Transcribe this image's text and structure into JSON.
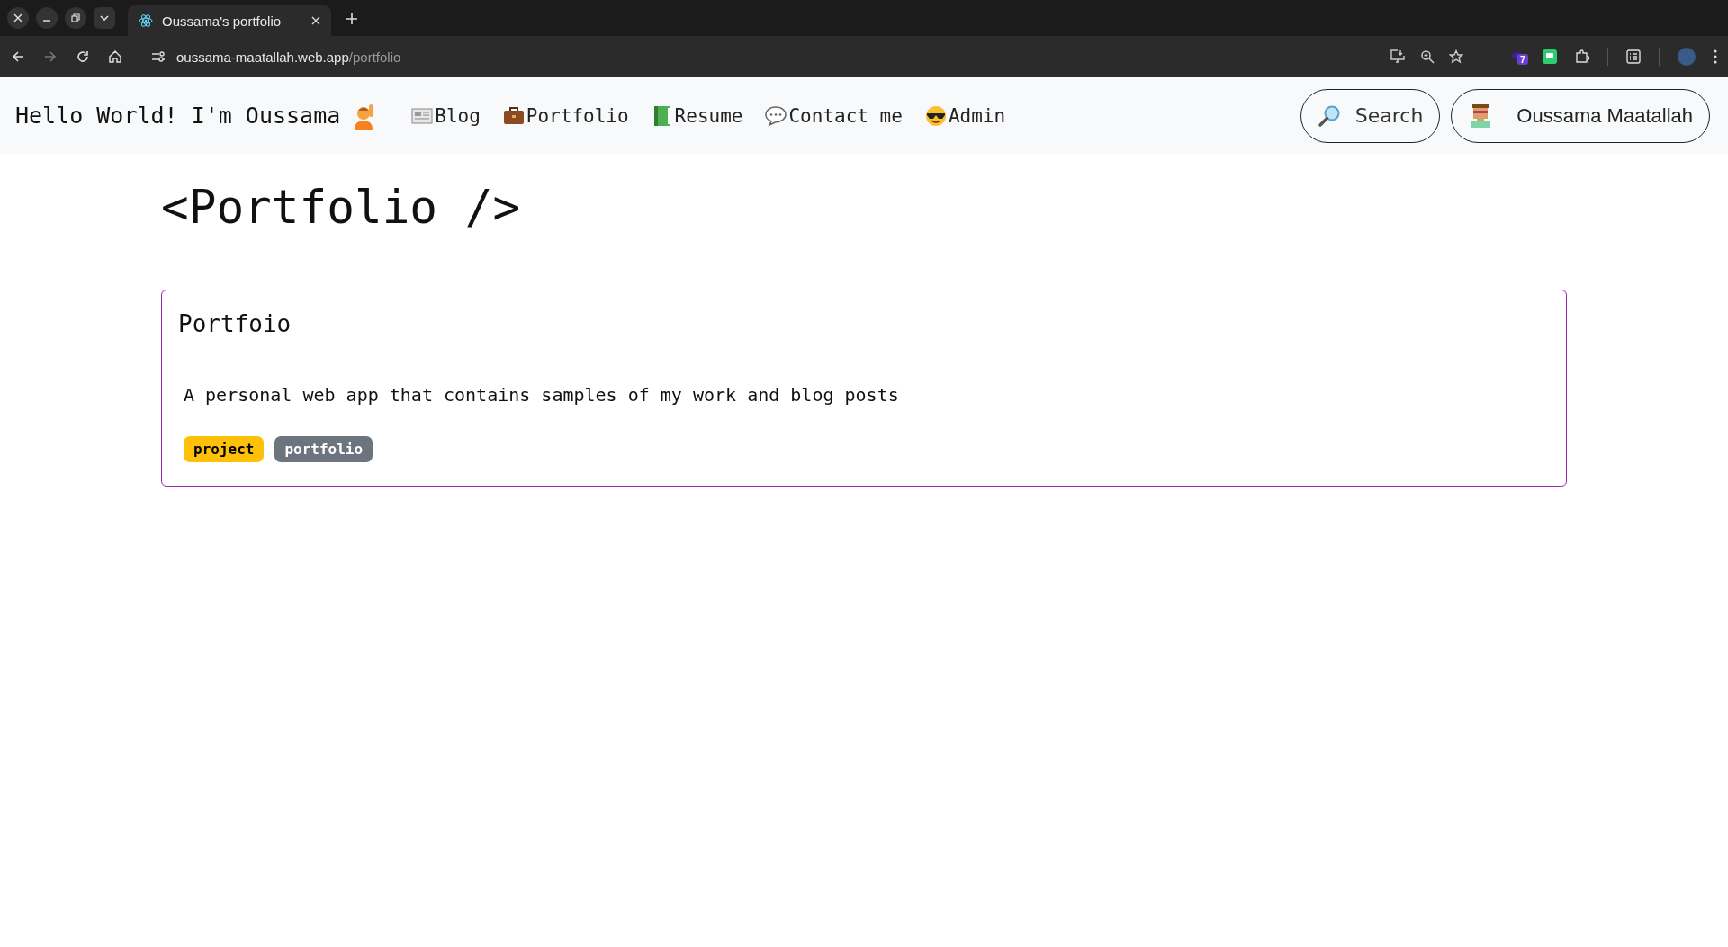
{
  "browser": {
    "tab_title": "Oussama's portfolio",
    "url_host": "oussama-maatallah.web.app",
    "url_path": "/portfolio",
    "extension_badge": "7"
  },
  "navbar": {
    "brand": "Hello World! I'm Oussama",
    "links": [
      {
        "label": "Blog",
        "kind": "news"
      },
      {
        "label": "Portfolio",
        "kind": "briefcase"
      },
      {
        "label": "Resume",
        "kind": "book"
      },
      {
        "label": "Contact me",
        "kind": "speech"
      },
      {
        "label": "Admin",
        "kind": "sunglasses"
      }
    ],
    "search_button": "Search",
    "user_button": "Oussama Maatallah"
  },
  "page_title": "<Portfolio />",
  "projects": [
    {
      "title": "Portfoio",
      "description": "A personal web app that contains samples of my work and blog posts",
      "tags": [
        {
          "label": "project",
          "color": "#ffc107"
        },
        {
          "label": "portfolio",
          "color": "#6c757d"
        }
      ]
    }
  ]
}
